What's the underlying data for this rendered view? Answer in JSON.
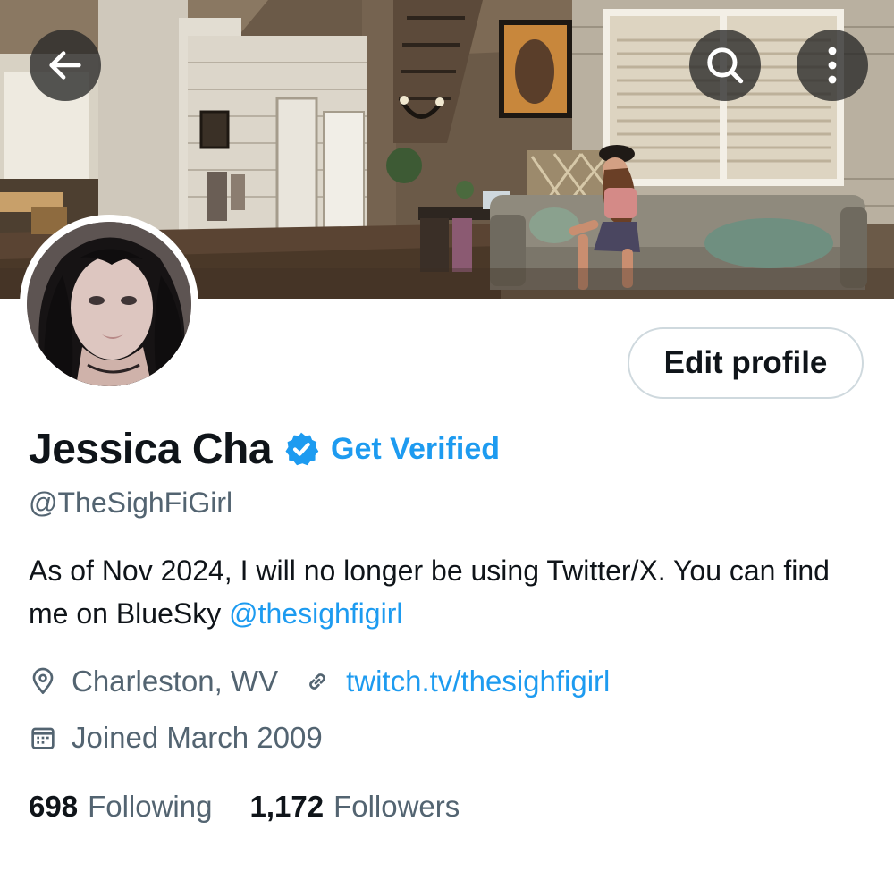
{
  "header": {
    "back_icon": "arrow-left-icon",
    "search_icon": "search-icon",
    "more_icon": "more-vertical-icon"
  },
  "profile": {
    "display_name": "Jessica Cha",
    "handle": "@TheSighFiGirl",
    "get_verified_label": "Get Verified",
    "verified_badge_color": "#1d9bf0",
    "edit_profile_label": "Edit profile",
    "bio_text": "As of Nov 2024, I will no longer be using Twitter/X. You can find me on BlueSky ",
    "bio_mention": "@thesighfigirl",
    "location": "Charleston, WV",
    "website": "twitch.tv/thesighfigirl",
    "joined": "Joined March 2009",
    "following_count": "698",
    "following_label": "Following",
    "followers_count": "1,172",
    "followers_label": "Followers"
  },
  "colors": {
    "accent": "#1d9bf0",
    "text_primary": "#0f1419",
    "text_secondary": "#536471",
    "border": "#cfd9de"
  }
}
